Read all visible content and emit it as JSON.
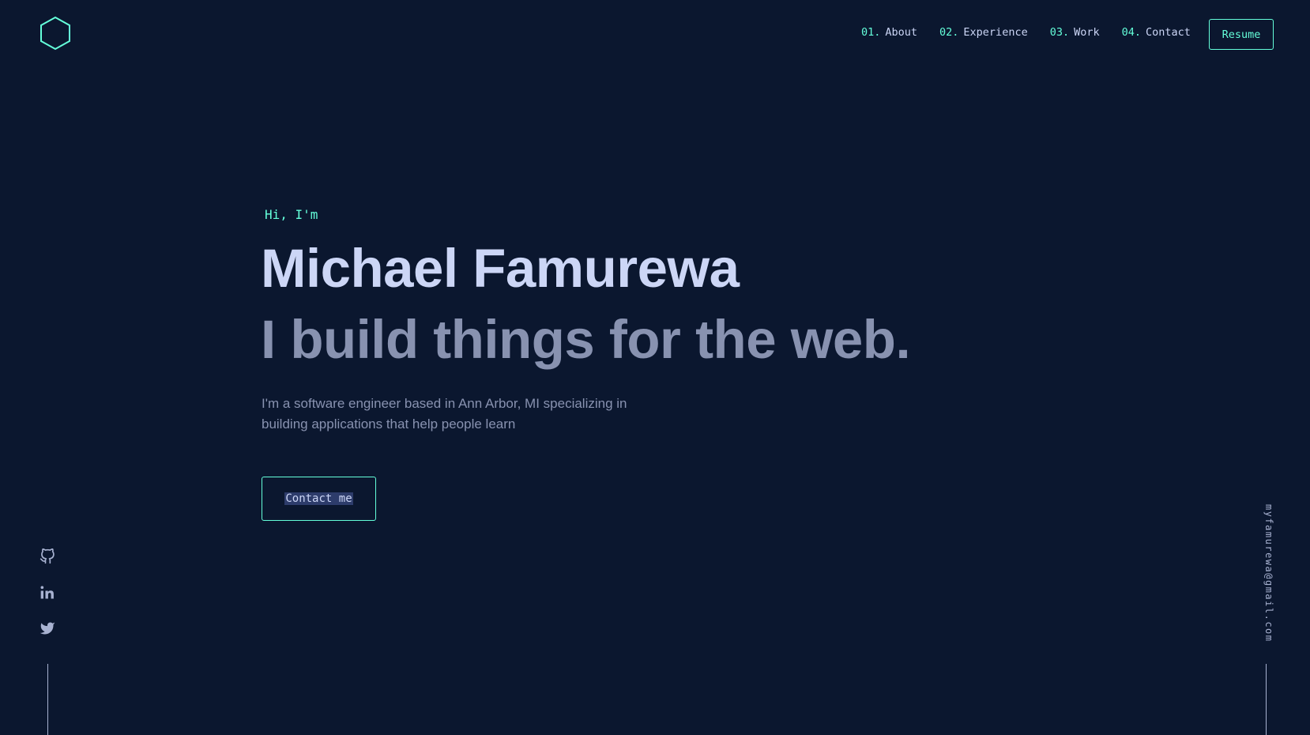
{
  "header": {
    "logo_icon": "hexagon-logo-icon",
    "nav": [
      {
        "num": "01.",
        "label": "About"
      },
      {
        "num": "02.",
        "label": "Experience"
      },
      {
        "num": "03.",
        "label": "Work"
      },
      {
        "num": "04.",
        "label": "Contact"
      }
    ],
    "resume_label": "Resume"
  },
  "hero": {
    "greeting": "Hi, I'm",
    "name": "Michael Famurewa",
    "tagline": "I build things for the web.",
    "description": "I'm a software engineer based in Ann Arbor, MI specializing in building applications that help people learn",
    "contact_label": "Contact me"
  },
  "social": {
    "icons": [
      "github-icon",
      "linkedin-icon",
      "twitter-icon"
    ]
  },
  "email": "myfamurewa@gmail.com",
  "colors": {
    "background": "#0b172f",
    "accent": "#64ffda",
    "heading": "#ccd6f6",
    "text": "#8892b0",
    "highlight": "#2d3c6b"
  }
}
